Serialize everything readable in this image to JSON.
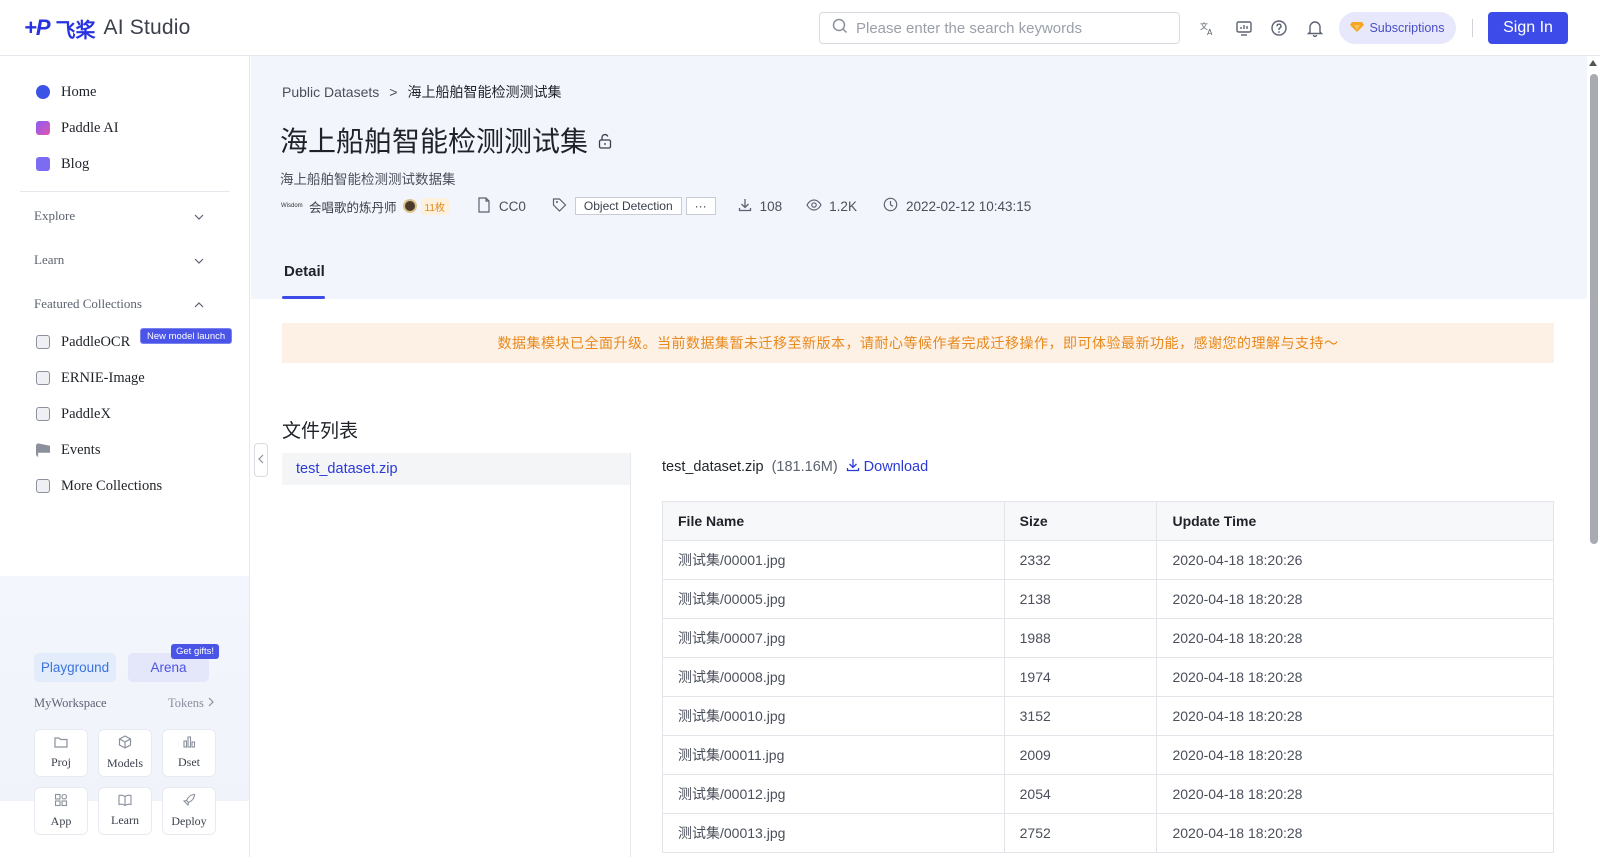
{
  "brand": {
    "logo_mark": "+P",
    "logo_cn": "飞桨",
    "product": "AI Studio"
  },
  "search": {
    "placeholder": "Please enter the search keywords"
  },
  "topbar": {
    "subscriptions_label": "Subscriptions",
    "signin_label": "Sign In"
  },
  "sidebar": {
    "items": [
      {
        "label": "Home",
        "icon": "planet-icon"
      },
      {
        "label": "Paddle AI",
        "icon": "robot-icon"
      },
      {
        "label": "Blog",
        "icon": "note-icon"
      }
    ],
    "groups": [
      {
        "label": "Explore",
        "expanded": false
      },
      {
        "label": "Learn",
        "expanded": false
      },
      {
        "label": "Featured Collections",
        "expanded": true
      }
    ],
    "collections": [
      {
        "label": "PaddleOCR",
        "icon": "ocr-icon"
      },
      {
        "label": "ERNIE-Image",
        "icon": "image-icon"
      },
      {
        "label": "PaddleX",
        "icon": "paddlex-icon"
      },
      {
        "label": "Events",
        "icon": "flag-icon"
      },
      {
        "label": "More Collections",
        "icon": "collections-icon"
      }
    ],
    "new_badge": "New model launch",
    "playground_label": "Playground",
    "arena_label": "Arena",
    "gifts_badge": "Get gifts!",
    "workspace_label": "MyWorkspace",
    "tokens_label": "Tokens",
    "tiles": [
      {
        "label": "Proj",
        "icon": "folder-icon"
      },
      {
        "label": "Models",
        "icon": "cube-icon"
      },
      {
        "label": "Dset",
        "icon": "bar-chart-icon"
      },
      {
        "label": "App",
        "icon": "apps-icon"
      },
      {
        "label": "Learn",
        "icon": "book-icon"
      },
      {
        "label": "Deploy",
        "icon": "rocket-icon"
      }
    ]
  },
  "breadcrumb": {
    "parent": "Public Datasets",
    "separator": ">",
    "current": "海上船舶智能检测测试集"
  },
  "dataset": {
    "title": "海上船舶智能检测测试集",
    "subtitle": "海上船舶智能检测测试数据集",
    "avatar_text": "Wisdom",
    "author": "会唱歌的炼丹师",
    "medal": "11枚",
    "license": "CC0",
    "tag": "Object Detection",
    "more_tags": "···",
    "downloads": "108",
    "views": "1.2K",
    "updated": "2022-02-12 10:43:15"
  },
  "tabs": {
    "detail": "Detail"
  },
  "notice": "数据集模块已全面升级。当前数据集暂未迁移至新版本，请耐心等候作者完成迁移操作，即可体验最新功能，感谢您的理解与支持～",
  "files": {
    "section_title": "文件列表",
    "selected_file": "test_dataset.zip",
    "file_name": "test_dataset.zip",
    "file_size": "(181.16M)",
    "download_label": "Download",
    "columns": [
      "File Name",
      "Size",
      "Update Time"
    ],
    "rows": [
      [
        "测试集/00001.jpg",
        "2332",
        "2020-04-18 18:20:26"
      ],
      [
        "测试集/00005.jpg",
        "2138",
        "2020-04-18 18:20:28"
      ],
      [
        "测试集/00007.jpg",
        "1988",
        "2020-04-18 18:20:28"
      ],
      [
        "测试集/00008.jpg",
        "1974",
        "2020-04-18 18:20:28"
      ],
      [
        "测试集/00010.jpg",
        "3152",
        "2020-04-18 18:20:28"
      ],
      [
        "测试集/00011.jpg",
        "2009",
        "2020-04-18 18:20:28"
      ],
      [
        "测试集/00012.jpg",
        "2054",
        "2020-04-18 18:20:28"
      ],
      [
        "测试集/00013.jpg",
        "2752",
        "2020-04-18 18:20:28"
      ]
    ]
  },
  "colors": {
    "accent": "#3d4ce8",
    "link": "#2b3ad6",
    "notice_bg": "#fdf0e4",
    "notice_text": "#e8891d"
  }
}
